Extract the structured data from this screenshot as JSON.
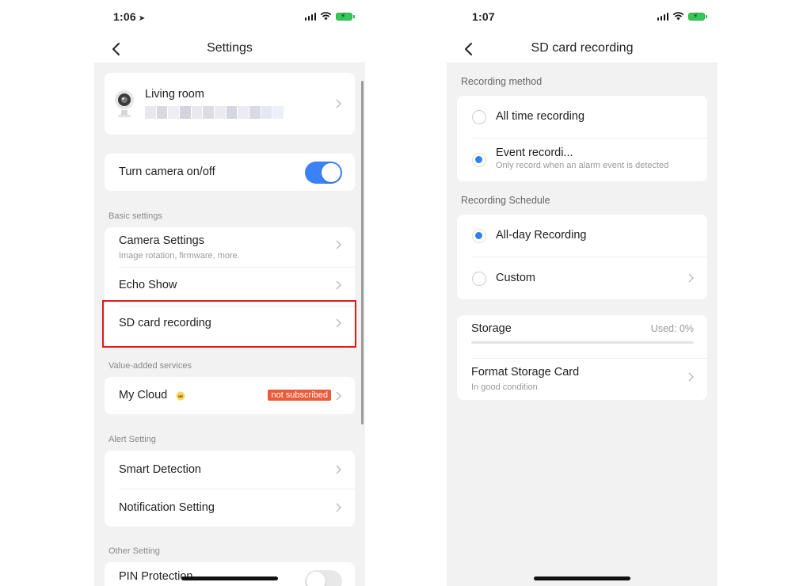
{
  "left_screen": {
    "status_time": "1:06",
    "nav_title": "Settings",
    "device": {
      "name": "Living room"
    },
    "camera_toggle": {
      "label": "Turn camera on/off",
      "on": true
    },
    "sections": {
      "basic": "Basic settings",
      "value_added": "Value-added services",
      "alert": "Alert Setting",
      "other": "Other Setting"
    },
    "basic_items": {
      "camera_settings": {
        "title": "Camera Settings",
        "subtitle": "Image rotation, firmware, more."
      },
      "echo_show": {
        "title": "Echo Show"
      },
      "sd_card": {
        "title": "SD card recording"
      }
    },
    "value_added_items": {
      "my_cloud": {
        "title": "My Cloud",
        "badge": "not subscribed"
      }
    },
    "alert_items": {
      "smart_detection": {
        "title": "Smart Detection"
      },
      "notification": {
        "title": "Notification Setting"
      }
    },
    "other_items": {
      "pin": {
        "title": "PIN Protection",
        "on": false
      }
    }
  },
  "right_screen": {
    "status_time": "1:07",
    "nav_title": "SD card recording",
    "method_label": "Recording method",
    "methods": {
      "all_time": {
        "title": "All time recording",
        "selected": false
      },
      "event": {
        "title": "Event recordi...",
        "subtitle": "Only record when an alarm event is detected",
        "selected": true
      }
    },
    "schedule_label": "Recording Schedule",
    "schedules": {
      "all_day": {
        "title": "All-day Recording",
        "selected": true
      },
      "custom": {
        "title": "Custom",
        "selected": false
      }
    },
    "storage": {
      "title": "Storage",
      "used_text": "Used: 0%",
      "used_fraction": 0
    },
    "format": {
      "title": "Format Storage Card",
      "subtitle": "In good condition"
    }
  },
  "colors": {
    "accent": "#3b82f6",
    "radio_selected": "#2f80ed",
    "badge": "#ec5a3a",
    "highlight_box": "#e01919",
    "background": "#f2f2f2"
  }
}
